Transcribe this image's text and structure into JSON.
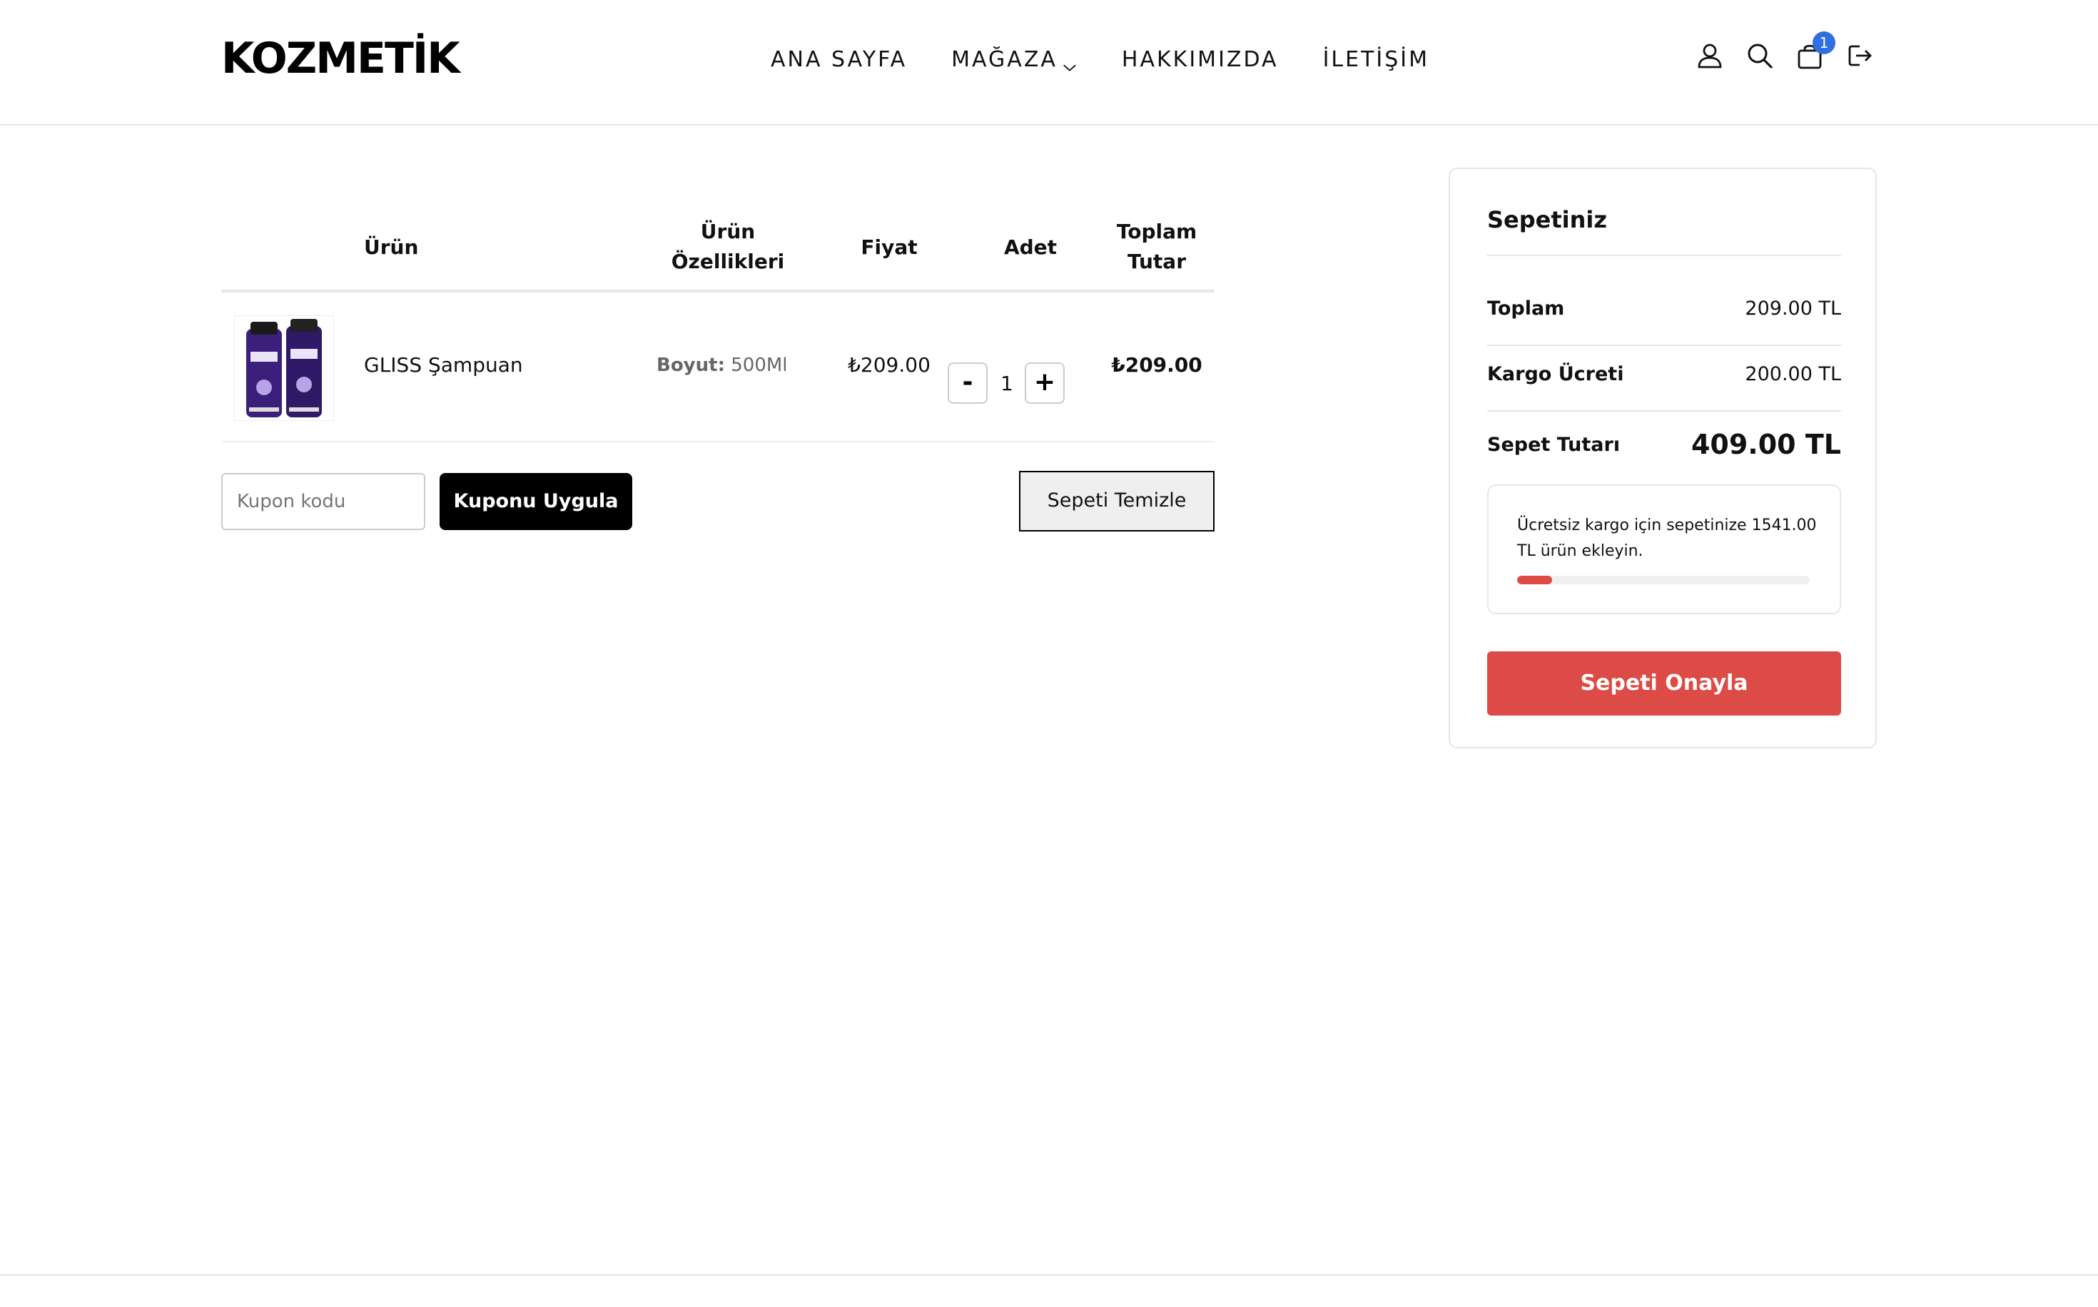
{
  "header": {
    "logo": "KOZMETİK",
    "nav": [
      {
        "label": "ANA SAYFA"
      },
      {
        "label": "MAĞAZA"
      },
      {
        "label": "HAKKIMIZDA"
      },
      {
        "label": "İLETİŞİM"
      }
    ],
    "cart_count": "1",
    "icons": [
      "user-icon",
      "search-icon",
      "shopping-bag-icon",
      "logout-icon"
    ]
  },
  "table": {
    "headers": {
      "product": "Ürün",
      "features_line1": "Ürün",
      "features_line2": "Özellikleri",
      "price": "Fiyat",
      "quantity": "Adet",
      "total_line1": "Toplam",
      "total_line2": "Tutar"
    },
    "rows": [
      {
        "name": "GLISS Şampuan",
        "feature_label": "Boyut:",
        "feature_value": "500Ml",
        "price": "₺209.00",
        "quantity": "1",
        "total": "₺209.00"
      }
    ],
    "minus": "-",
    "plus": "+"
  },
  "coupon": {
    "placeholder": "Kupon kodu",
    "apply_label": "Kuponu Uygula"
  },
  "clear_label": "Sepeti Temizle",
  "summary": {
    "title": "Sepetiniz",
    "subtotal_label": "Toplam",
    "subtotal_value": "209.00 TL",
    "shipping_label": "Kargo Ücreti",
    "shipping_value": "200.00 TL",
    "total_label": "Sepet Tutarı",
    "total_value": "409.00 TL",
    "free_shipping_text": "Ücretsiz kargo için sepetinize 1541.00 TL ürün ekleyin.",
    "free_shipping_progress": 0.12,
    "confirm_label": "Sepeti Onayla"
  },
  "colors": {
    "accent": "#dc4b45",
    "badge": "#2f6fe0"
  }
}
